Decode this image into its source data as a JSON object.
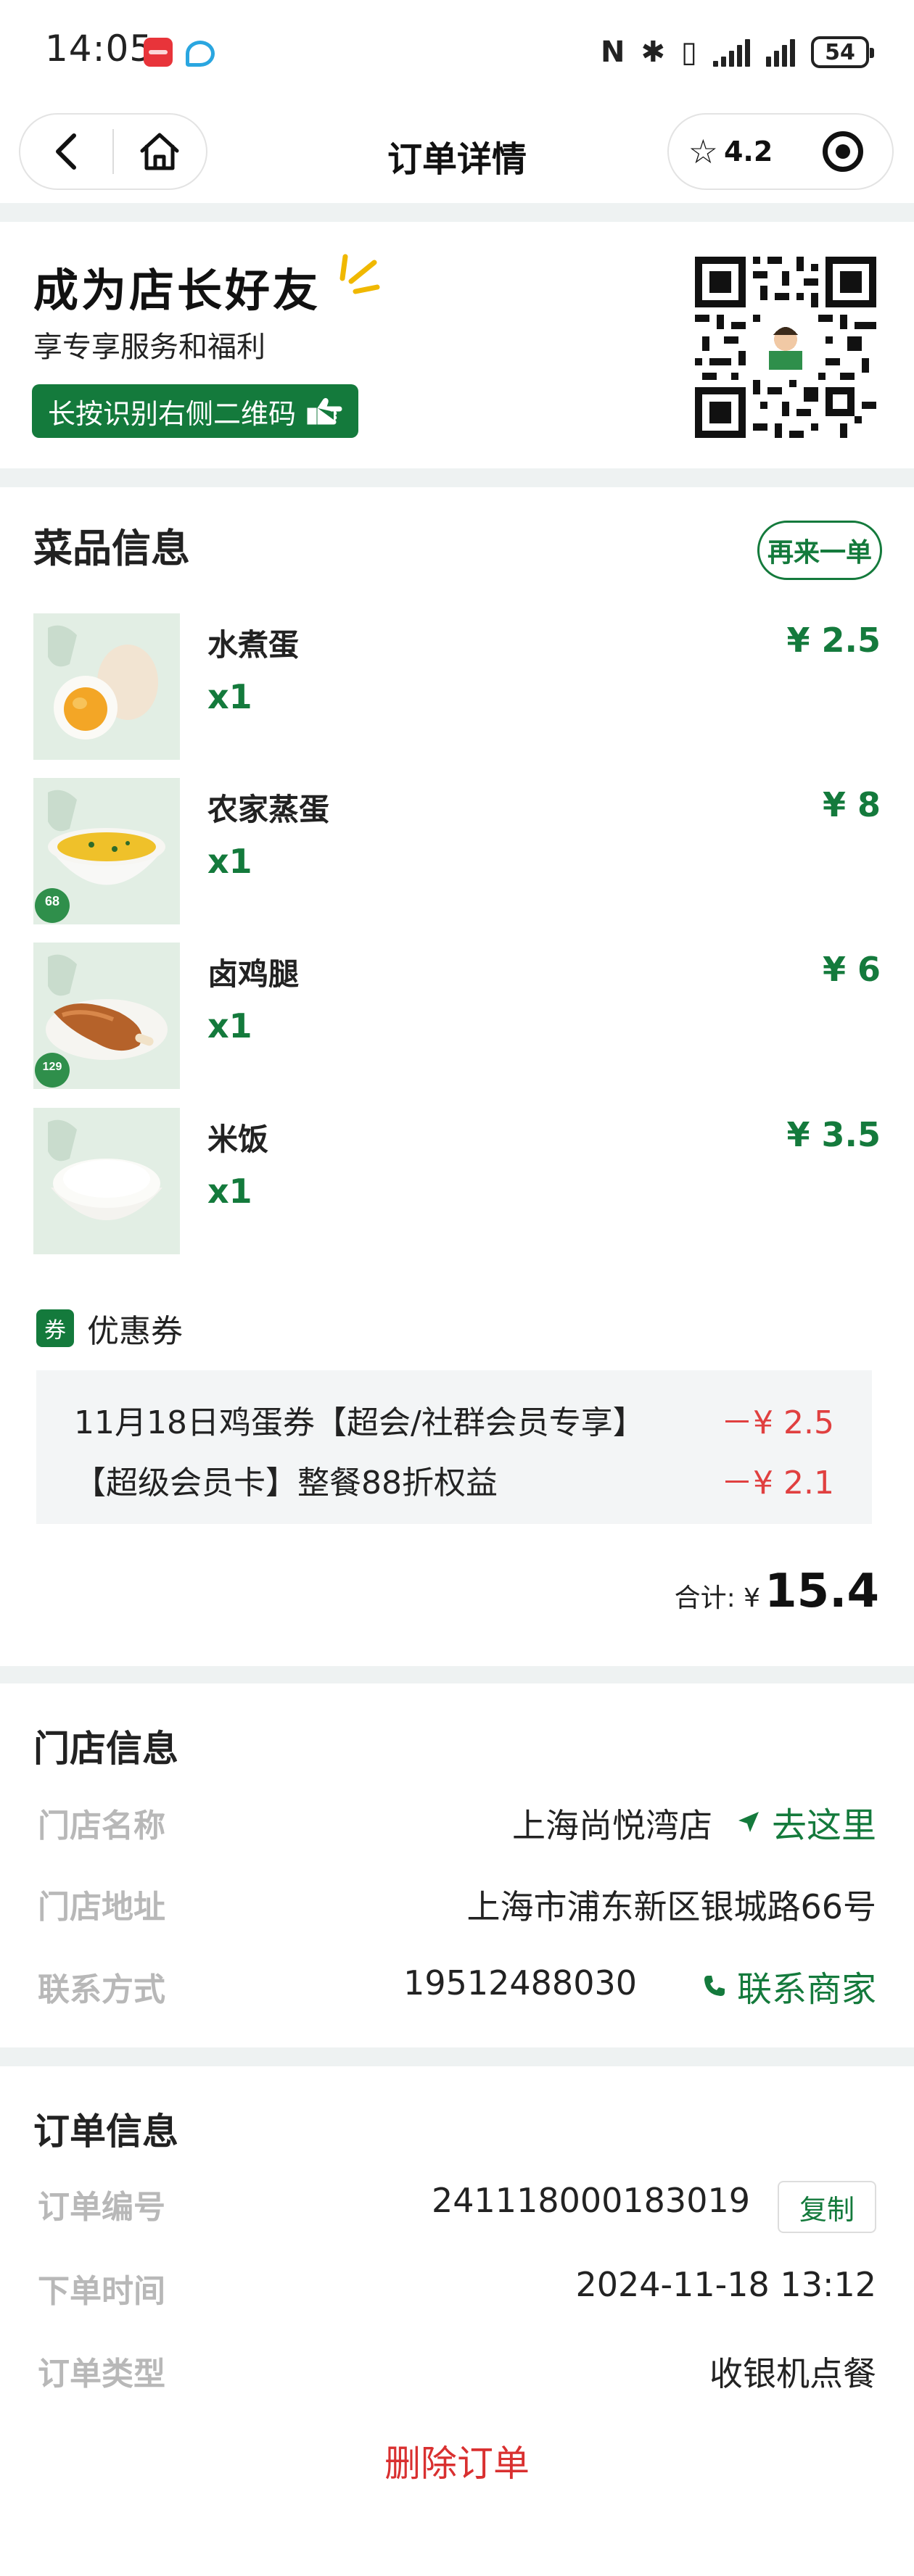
{
  "status_bar": {
    "time": "14:05",
    "battery": "54",
    "icons": [
      "nfc-icon",
      "bluetooth-icon",
      "vibrate-icon",
      "signal-icon",
      "battery-icon"
    ]
  },
  "nav": {
    "title": "订单详情",
    "rating": "4.2"
  },
  "friend_card": {
    "title": "成为店长好友",
    "subtitle": "享专享服务和福利",
    "button_label": "长按识别右侧二维码"
  },
  "dish_section": {
    "title": "菜品信息",
    "reorder_label": "再来一单",
    "items": [
      {
        "name": "水煮蛋",
        "qty": "x1",
        "price": "¥ 2.5",
        "image": "boiled-egg"
      },
      {
        "name": "农家蒸蛋",
        "qty": "x1",
        "price": "¥ 8",
        "image": "steamed-egg",
        "badge": "68"
      },
      {
        "name": "卤鸡腿",
        "qty": "x1",
        "price": "¥ 6",
        "image": "braised-drumstick",
        "badge": "129"
      },
      {
        "name": "米饭",
        "qty": "x1",
        "price": "¥ 3.5",
        "image": "rice"
      }
    ],
    "coupon_tag": "券",
    "coupon_label": "优惠券",
    "coupons": [
      {
        "name": "11月18日鸡蛋券【超会/社群会员专享】",
        "amount": "－¥ 2.5"
      },
      {
        "name": "【超级会员卡】整餐88折权益",
        "amount": "－¥ 2.1"
      }
    ],
    "total_label": "合计: ¥",
    "total_value": "15.4"
  },
  "store_section": {
    "title": "门店信息",
    "name_label": "门店名称",
    "name_value": "上海尚悦湾店",
    "go_label": "去这里",
    "address_label": "门店地址",
    "address_value": "上海市浦东新区银城路66号",
    "contact_label": "联系方式",
    "contact_value": "19512488030",
    "contact_link": "联系商家"
  },
  "order_section": {
    "title": "订单信息",
    "number_label": "订单编号",
    "number_value": "241118000183019",
    "copy_label": "复制",
    "time_label": "下单时间",
    "time_value": "2024-11-18 13:12",
    "type_label": "订单类型",
    "type_value": "收银机点餐",
    "delete_label": "删除订单"
  },
  "colors": {
    "brand_green": "#147a3c",
    "discount_red": "#e04040",
    "delete_red": "#d93030",
    "page_bg": "#eef2f2"
  }
}
